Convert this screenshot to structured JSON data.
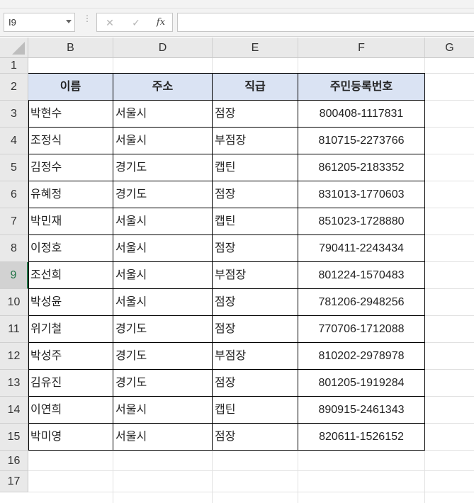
{
  "formula_bar": {
    "name_box": "I9",
    "cancel_glyph": "✕",
    "enter_glyph": "✓",
    "function_glyph": "fx",
    "formula_value": ""
  },
  "columns": [
    "B",
    "D",
    "E",
    "F",
    "G"
  ],
  "rows": [
    "1",
    "2",
    "3",
    "4",
    "5",
    "6",
    "7",
    "8",
    "9",
    "10",
    "11",
    "12",
    "13",
    "14",
    "15",
    "16",
    "17"
  ],
  "selected_row": "9",
  "table": {
    "headers": [
      "이름",
      "주소",
      "직급",
      "주민등록번호"
    ],
    "records": [
      [
        "박현수",
        "서울시",
        "점장",
        "800408-1117831"
      ],
      [
        "조정식",
        "서울시",
        "부점장",
        "810715-2273766"
      ],
      [
        "김정수",
        "경기도",
        "캡틴",
        "861205-2183352"
      ],
      [
        "유혜정",
        "경기도",
        "점장",
        "831013-1770603"
      ],
      [
        "박민재",
        "서울시",
        "캡틴",
        "851023-1728880"
      ],
      [
        "이정호",
        "서울시",
        "점장",
        "790411-2243434"
      ],
      [
        "조선희",
        "서울시",
        "부점장",
        "801224-1570483"
      ],
      [
        "박성윤",
        "서울시",
        "점장",
        "781206-2948256"
      ],
      [
        "위기철",
        "경기도",
        "점장",
        "770706-1712088"
      ],
      [
        "박성주",
        "경기도",
        "부점장",
        "810202-2978978"
      ],
      [
        "김유진",
        "경기도",
        "점장",
        "801205-1919284"
      ],
      [
        "이연희",
        "서울시",
        "캡틴",
        "890915-2461343"
      ],
      [
        "박미영",
        "서울시",
        "점장",
        "820611-1526152"
      ]
    ]
  },
  "colors": {
    "header_fill": "#dae3f3",
    "selected_row_accent": "#217346"
  }
}
